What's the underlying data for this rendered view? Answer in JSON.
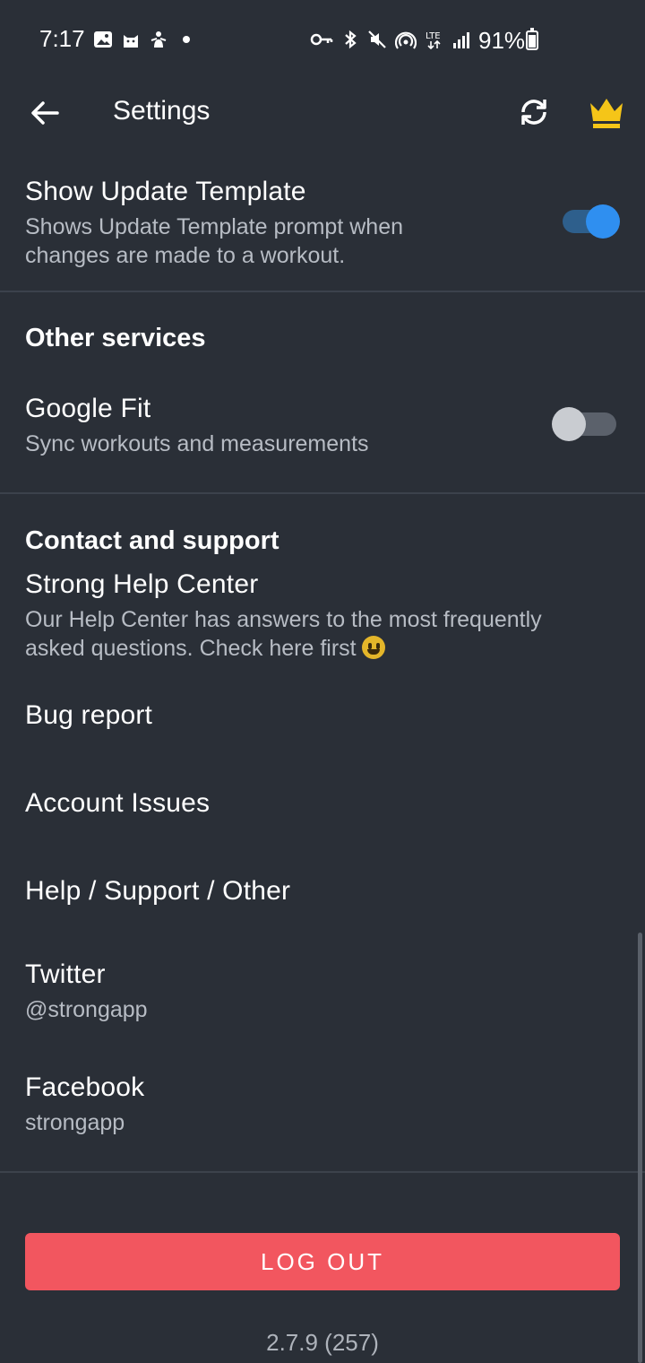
{
  "status_bar": {
    "time": "7:17",
    "battery": "91%",
    "left_icons": [
      "image-icon",
      "cat-icon",
      "figure-icon",
      "dot-icon"
    ],
    "right_icons": [
      "key-icon",
      "bluetooth-icon",
      "mute-icon",
      "hotspot-icon",
      "lte-icon",
      "signal-icon",
      "battery-icon"
    ]
  },
  "app_bar": {
    "title": "Settings"
  },
  "settings": {
    "update_template": {
      "title": "Show Update Template",
      "subtitle_line1": "Shows Update Template prompt when",
      "subtitle_line2": "changes are made to a workout.",
      "enabled": true
    },
    "other_services": {
      "header": "Other services",
      "google_fit": {
        "title": "Google Fit",
        "subtitle": "Sync workouts and measurements",
        "enabled": false
      }
    },
    "contact": {
      "header": "Contact and support",
      "help_center": {
        "title": "Strong Help Center",
        "subtitle_line1": "Our Help Center has answers to the most frequently",
        "subtitle_line2": "asked questions. Check here first"
      },
      "bug_report": "Bug report",
      "account_issues": "Account Issues",
      "help_support_other": "Help / Support / Other",
      "twitter": {
        "title": "Twitter",
        "handle": "@strongapp"
      },
      "facebook": {
        "title": "Facebook",
        "handle": "strongapp"
      }
    }
  },
  "logout_label": "LOG OUT",
  "version": "2.7.9 (257)",
  "colors": {
    "background": "#2a2f37",
    "accent": "#2f8ff0",
    "logout": "#f2565f",
    "crown": "#f5c518"
  }
}
